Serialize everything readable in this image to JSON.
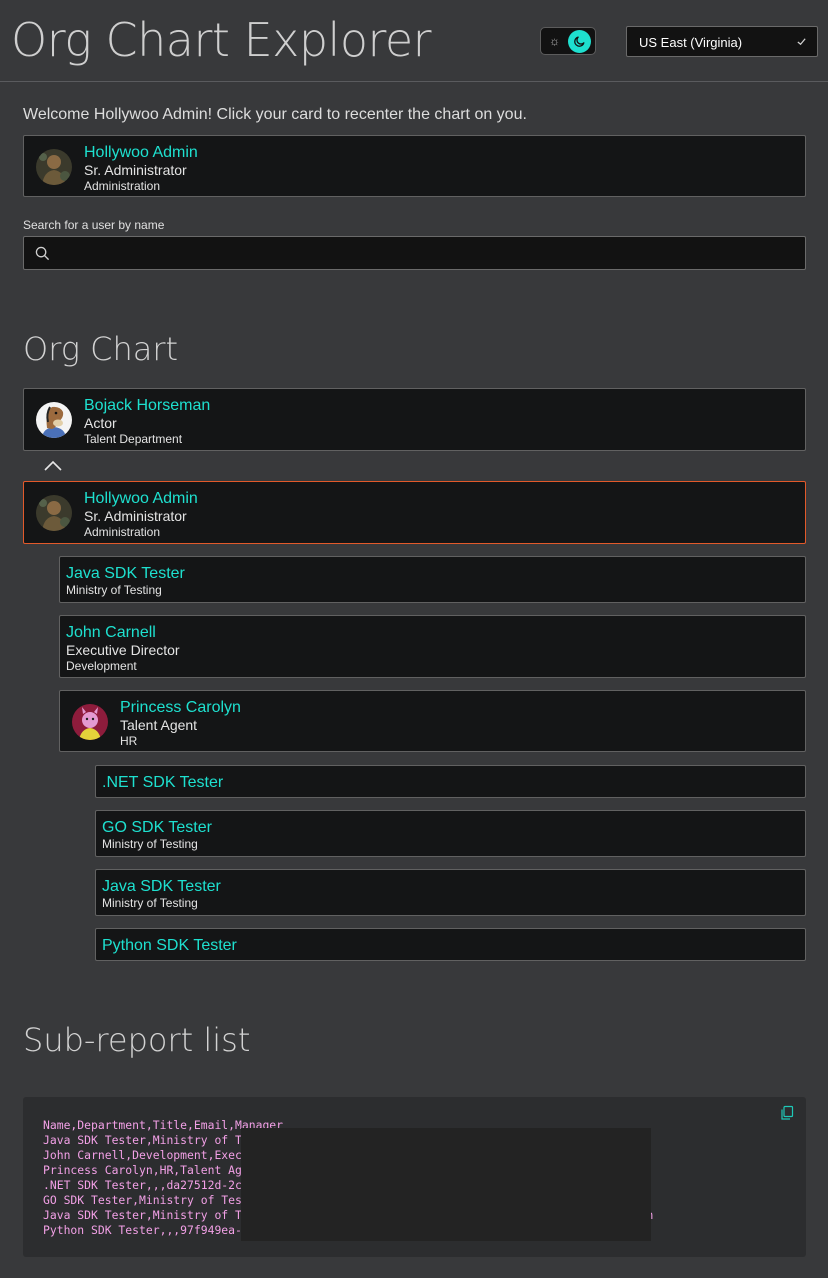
{
  "header": {
    "title": "Org Chart Explorer",
    "theme_toggle": {
      "mode": "dark",
      "sun_icon": "sun-icon",
      "moon_icon": "moon-icon",
      "accent": "#1ee0cf"
    },
    "region": {
      "selected": "US East (Virginia)"
    }
  },
  "welcome": {
    "message": "Welcome Hollywoo Admin! Click your card to recenter the chart on you.",
    "user": {
      "name": "Hollywoo Admin",
      "title": "Sr. Administrator",
      "department": "Administration"
    }
  },
  "search": {
    "label": "Search for a user by name",
    "value": "",
    "placeholder": ""
  },
  "org_chart": {
    "heading": "Org Chart",
    "manager": {
      "name": "Bojack Horseman",
      "title": "Actor",
      "department": "Talent Department"
    },
    "current": {
      "name": "Hollywoo Admin",
      "title": "Sr. Administrator",
      "department": "Administration"
    },
    "reports": [
      {
        "name": "Java SDK Tester",
        "department": "Ministry of Testing"
      },
      {
        "name": "John Carnell",
        "title": "Executive Director",
        "department": "Development"
      },
      {
        "name": "Princess Carolyn",
        "title": "Talent Agent",
        "department": "HR"
      }
    ],
    "sub_reports": [
      {
        "name": ".NET SDK Tester"
      },
      {
        "name": "GO SDK Tester",
        "department": "Ministry of Testing"
      },
      {
        "name": "Java SDK Tester",
        "department": "Ministry of Testing"
      },
      {
        "name": "Python SDK Tester"
      }
    ]
  },
  "sub_report_list": {
    "heading": "Sub-report list",
    "lines": [
      "Name,Department,Title,Email,Manager",
      "Java SDK Tester,Ministry of T                                         om,Hollywoo Admin",
      "John Carnell,Development,Exec",
      "Princess Carolyn,HR,Talent Ag                                         n",
      ".NET SDK Tester,,,da27512d-2c",
      "GO SDK Tester,Ministry of Tes                                         ,Princess Carolyn",
      "Java SDK Tester,Ministry of T                                         om,Princess Carolyn",
      "Python SDK Tester,,,97f949ea-                                         yn"
    ]
  }
}
